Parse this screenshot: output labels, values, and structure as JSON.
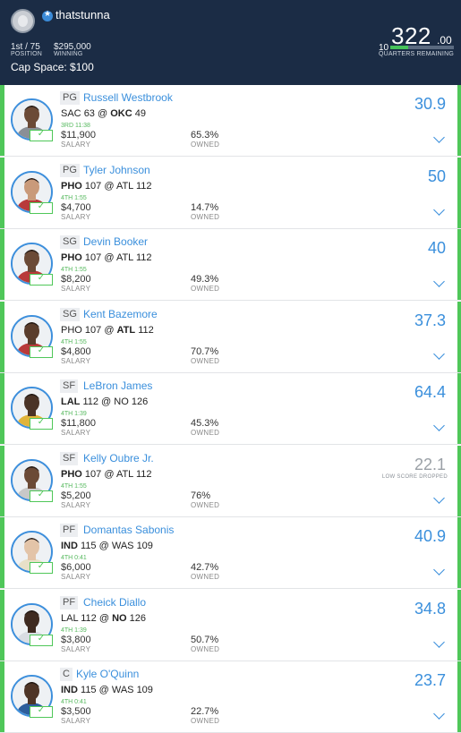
{
  "header": {
    "username": "thatstunna",
    "position_value": "1st / 75",
    "position_label": "POSITION",
    "winning_value": "$295,000",
    "winning_label": "WINNING",
    "cap_space": "Cap Space: $100",
    "score_int": "322",
    "score_dec": ".00",
    "quarters_count": "10",
    "quarters_label": "QUARTERS REMAINING",
    "quarters_progress": 0.28,
    "accent": "#46c25a"
  },
  "players": [
    {
      "pos": "PG",
      "name": "Russell Westbrook",
      "g1": "SAC",
      "s1": "63",
      "g2": "OKC",
      "s2": "49",
      "bold": "OKC",
      "clock": "3RD 11:38",
      "salary": "$11,900",
      "salary_label": "SALARY",
      "owned": "65.3%",
      "owned_label": "OWNED",
      "pts": "30.9",
      "dropped": false,
      "drop_label": ""
    },
    {
      "pos": "PG",
      "name": "Tyler Johnson",
      "g1": "PHO",
      "s1": "107",
      "g2": "ATL",
      "s2": "112",
      "bold": "PHO",
      "clock": "4TH 1:55",
      "salary": "$4,700",
      "salary_label": "SALARY",
      "owned": "14.7%",
      "owned_label": "OWNED",
      "pts": "50",
      "dropped": false,
      "drop_label": ""
    },
    {
      "pos": "SG",
      "name": "Devin Booker",
      "g1": "PHO",
      "s1": "107",
      "g2": "ATL",
      "s2": "112",
      "bold": "PHO",
      "clock": "4TH 1:55",
      "salary": "$8,200",
      "salary_label": "SALARY",
      "owned": "49.3%",
      "owned_label": "OWNED",
      "pts": "40",
      "dropped": false,
      "drop_label": ""
    },
    {
      "pos": "SG",
      "name": "Kent Bazemore",
      "g1": "PHO",
      "s1": "107",
      "g2": "ATL",
      "s2": "112",
      "bold": "ATL",
      "clock": "4TH 1:55",
      "salary": "$4,800",
      "salary_label": "SALARY",
      "owned": "70.7%",
      "owned_label": "OWNED",
      "pts": "37.3",
      "dropped": false,
      "drop_label": ""
    },
    {
      "pos": "SF",
      "name": "LeBron James",
      "g1": "LAL",
      "s1": "112",
      "g2": "NO",
      "s2": "126",
      "bold": "LAL",
      "clock": "4TH 1:39",
      "salary": "$11,800",
      "salary_label": "SALARY",
      "owned": "45.3%",
      "owned_label": "OWNED",
      "pts": "64.4",
      "dropped": false,
      "drop_label": ""
    },
    {
      "pos": "SF",
      "name": "Kelly Oubre Jr.",
      "g1": "PHO",
      "s1": "107",
      "g2": "ATL",
      "s2": "112",
      "bold": "PHO",
      "clock": "4TH 1:55",
      "salary": "$5,200",
      "salary_label": "SALARY",
      "owned": "76%",
      "owned_label": "OWNED",
      "pts": "22.1",
      "dropped": true,
      "drop_label": "LOW SCORE DROPPED"
    },
    {
      "pos": "PF",
      "name": "Domantas Sabonis",
      "g1": "IND",
      "s1": "115",
      "g2": "WAS",
      "s2": "109",
      "bold": "IND",
      "clock": "4TH 0:41",
      "salary": "$6,000",
      "salary_label": "SALARY",
      "owned": "42.7%",
      "owned_label": "OWNED",
      "pts": "40.9",
      "dropped": false,
      "drop_label": ""
    },
    {
      "pos": "PF",
      "name": "Cheick Diallo",
      "g1": "LAL",
      "s1": "112",
      "g2": "NO",
      "s2": "126",
      "bold": "NO",
      "clock": "4TH 1:39",
      "salary": "$3,800",
      "salary_label": "SALARY",
      "owned": "50.7%",
      "owned_label": "OWNED",
      "pts": "34.8",
      "dropped": false,
      "drop_label": ""
    },
    {
      "pos": "C",
      "name": "Kyle O'Quinn",
      "g1": "IND",
      "s1": "115",
      "g2": "WAS",
      "s2": "109",
      "bold": "IND",
      "clock": "4TH 0:41",
      "salary": "$3,500",
      "salary_label": "SALARY",
      "owned": "22.7%",
      "owned_label": "OWNED",
      "pts": "23.7",
      "dropped": false,
      "drop_label": ""
    }
  ]
}
